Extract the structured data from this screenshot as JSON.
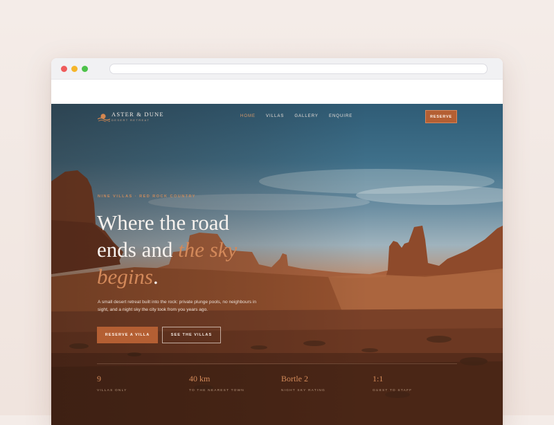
{
  "brand": {
    "name": "ASTER & DUNE",
    "tagline": "DESERT RETREAT"
  },
  "nav": {
    "items": [
      {
        "label": "HOME",
        "active": true
      },
      {
        "label": "VILLAS",
        "active": false
      },
      {
        "label": "GALLERY",
        "active": false
      },
      {
        "label": "ENQUIRE",
        "active": false
      }
    ],
    "cta": "RESERVE"
  },
  "hero": {
    "eyebrow": "NINE VILLAS · RED ROCK COUNTRY",
    "headline_line1": "Where the road",
    "headline_line2a": "ends and ",
    "headline_line2b": "the sky",
    "headline_line3a": "begins",
    "headline_line3b": ".",
    "lede": "A small desert retreat built into the rock: private plunge pools, no neighbours in sight, and a night sky the city took from you years ago.",
    "primary_button": "RESERVE A VILLA",
    "secondary_button": "SEE THE VILLAS"
  },
  "stats": [
    {
      "value": "9",
      "label": "VILLAS ONLY"
    },
    {
      "value": "40 km",
      "label": "TO THE NEAREST TOWN"
    },
    {
      "value": "Bortle 2",
      "label": "NIGHT SKY RATING"
    },
    {
      "value": "1:1",
      "label": "GUEST TO STAFF"
    }
  ],
  "colors": {
    "accent": "#b45f33",
    "accent_text": "#d3895a",
    "window_dot_red": "#ef5b5b",
    "window_dot_yellow": "#f5b52a",
    "window_dot_green": "#4dc24a"
  }
}
